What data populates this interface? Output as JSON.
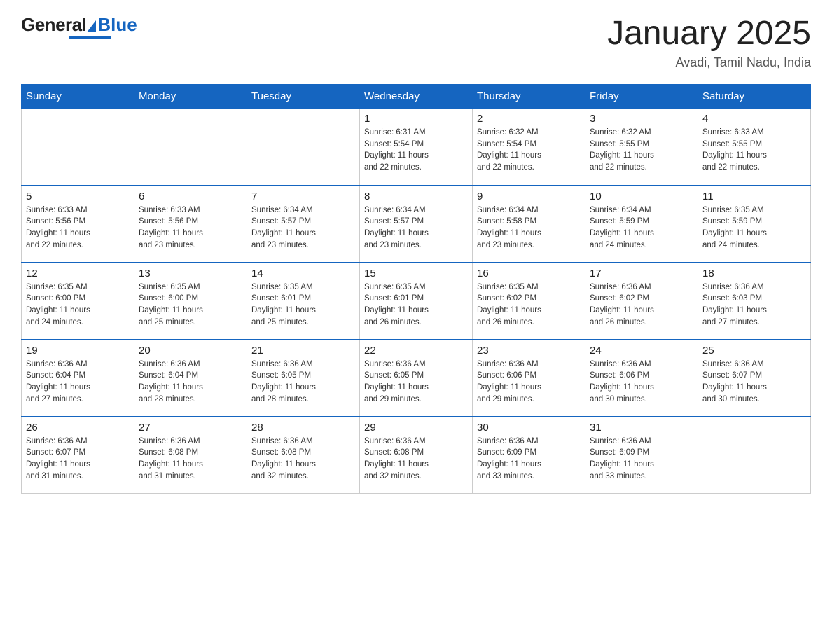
{
  "header": {
    "logo_general": "General",
    "logo_blue": "Blue",
    "month_title": "January 2025",
    "location": "Avadi, Tamil Nadu, India"
  },
  "days_of_week": [
    "Sunday",
    "Monday",
    "Tuesday",
    "Wednesday",
    "Thursday",
    "Friday",
    "Saturday"
  ],
  "weeks": [
    [
      {
        "day": "",
        "info": ""
      },
      {
        "day": "",
        "info": ""
      },
      {
        "day": "",
        "info": ""
      },
      {
        "day": "1",
        "info": "Sunrise: 6:31 AM\nSunset: 5:54 PM\nDaylight: 11 hours\nand 22 minutes."
      },
      {
        "day": "2",
        "info": "Sunrise: 6:32 AM\nSunset: 5:54 PM\nDaylight: 11 hours\nand 22 minutes."
      },
      {
        "day": "3",
        "info": "Sunrise: 6:32 AM\nSunset: 5:55 PM\nDaylight: 11 hours\nand 22 minutes."
      },
      {
        "day": "4",
        "info": "Sunrise: 6:33 AM\nSunset: 5:55 PM\nDaylight: 11 hours\nand 22 minutes."
      }
    ],
    [
      {
        "day": "5",
        "info": "Sunrise: 6:33 AM\nSunset: 5:56 PM\nDaylight: 11 hours\nand 22 minutes."
      },
      {
        "day": "6",
        "info": "Sunrise: 6:33 AM\nSunset: 5:56 PM\nDaylight: 11 hours\nand 23 minutes."
      },
      {
        "day": "7",
        "info": "Sunrise: 6:34 AM\nSunset: 5:57 PM\nDaylight: 11 hours\nand 23 minutes."
      },
      {
        "day": "8",
        "info": "Sunrise: 6:34 AM\nSunset: 5:57 PM\nDaylight: 11 hours\nand 23 minutes."
      },
      {
        "day": "9",
        "info": "Sunrise: 6:34 AM\nSunset: 5:58 PM\nDaylight: 11 hours\nand 23 minutes."
      },
      {
        "day": "10",
        "info": "Sunrise: 6:34 AM\nSunset: 5:59 PM\nDaylight: 11 hours\nand 24 minutes."
      },
      {
        "day": "11",
        "info": "Sunrise: 6:35 AM\nSunset: 5:59 PM\nDaylight: 11 hours\nand 24 minutes."
      }
    ],
    [
      {
        "day": "12",
        "info": "Sunrise: 6:35 AM\nSunset: 6:00 PM\nDaylight: 11 hours\nand 24 minutes."
      },
      {
        "day": "13",
        "info": "Sunrise: 6:35 AM\nSunset: 6:00 PM\nDaylight: 11 hours\nand 25 minutes."
      },
      {
        "day": "14",
        "info": "Sunrise: 6:35 AM\nSunset: 6:01 PM\nDaylight: 11 hours\nand 25 minutes."
      },
      {
        "day": "15",
        "info": "Sunrise: 6:35 AM\nSunset: 6:01 PM\nDaylight: 11 hours\nand 26 minutes."
      },
      {
        "day": "16",
        "info": "Sunrise: 6:35 AM\nSunset: 6:02 PM\nDaylight: 11 hours\nand 26 minutes."
      },
      {
        "day": "17",
        "info": "Sunrise: 6:36 AM\nSunset: 6:02 PM\nDaylight: 11 hours\nand 26 minutes."
      },
      {
        "day": "18",
        "info": "Sunrise: 6:36 AM\nSunset: 6:03 PM\nDaylight: 11 hours\nand 27 minutes."
      }
    ],
    [
      {
        "day": "19",
        "info": "Sunrise: 6:36 AM\nSunset: 6:04 PM\nDaylight: 11 hours\nand 27 minutes."
      },
      {
        "day": "20",
        "info": "Sunrise: 6:36 AM\nSunset: 6:04 PM\nDaylight: 11 hours\nand 28 minutes."
      },
      {
        "day": "21",
        "info": "Sunrise: 6:36 AM\nSunset: 6:05 PM\nDaylight: 11 hours\nand 28 minutes."
      },
      {
        "day": "22",
        "info": "Sunrise: 6:36 AM\nSunset: 6:05 PM\nDaylight: 11 hours\nand 29 minutes."
      },
      {
        "day": "23",
        "info": "Sunrise: 6:36 AM\nSunset: 6:06 PM\nDaylight: 11 hours\nand 29 minutes."
      },
      {
        "day": "24",
        "info": "Sunrise: 6:36 AM\nSunset: 6:06 PM\nDaylight: 11 hours\nand 30 minutes."
      },
      {
        "day": "25",
        "info": "Sunrise: 6:36 AM\nSunset: 6:07 PM\nDaylight: 11 hours\nand 30 minutes."
      }
    ],
    [
      {
        "day": "26",
        "info": "Sunrise: 6:36 AM\nSunset: 6:07 PM\nDaylight: 11 hours\nand 31 minutes."
      },
      {
        "day": "27",
        "info": "Sunrise: 6:36 AM\nSunset: 6:08 PM\nDaylight: 11 hours\nand 31 minutes."
      },
      {
        "day": "28",
        "info": "Sunrise: 6:36 AM\nSunset: 6:08 PM\nDaylight: 11 hours\nand 32 minutes."
      },
      {
        "day": "29",
        "info": "Sunrise: 6:36 AM\nSunset: 6:08 PM\nDaylight: 11 hours\nand 32 minutes."
      },
      {
        "day": "30",
        "info": "Sunrise: 6:36 AM\nSunset: 6:09 PM\nDaylight: 11 hours\nand 33 minutes."
      },
      {
        "day": "31",
        "info": "Sunrise: 6:36 AM\nSunset: 6:09 PM\nDaylight: 11 hours\nand 33 minutes."
      },
      {
        "day": "",
        "info": ""
      }
    ]
  ]
}
